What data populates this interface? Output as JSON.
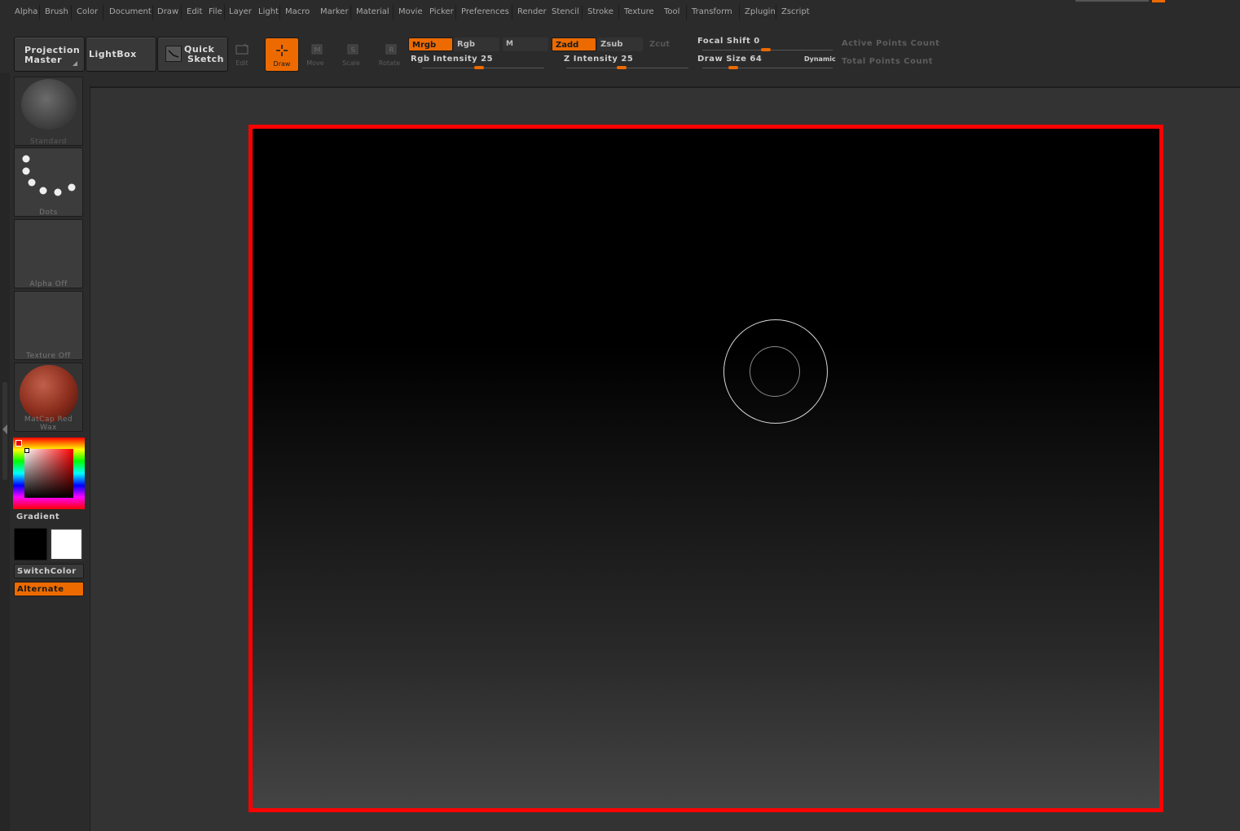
{
  "menu": [
    "Alpha",
    "Brush",
    "Color",
    "Document",
    "Draw",
    "Edit",
    "File",
    "Layer",
    "Light",
    "Macro",
    "Marker",
    "Material",
    "Movie",
    "Picker",
    "Preferences",
    "Render",
    "Stencil",
    "Stroke",
    "Texture",
    "Tool",
    "Transform",
    "Zplugin",
    "Zscript"
  ],
  "toolbar": {
    "projection_master": {
      "line1": "Projection",
      "line2": "Master"
    },
    "lightbox": "LightBox",
    "quick_sketch": {
      "line1": "Quick",
      "line2": "Sketch"
    },
    "edit": "Edit",
    "draw": "Draw",
    "move": "Move",
    "scale": "Scale",
    "rotate": "Rotate",
    "mrgb": "Mrgb",
    "rgb": "Rgb",
    "m": "M",
    "zadd": "Zadd",
    "zsub": "Zsub",
    "zcut": "Zcut",
    "rgb_intensity": "Rgb Intensity 25",
    "z_intensity": "Z Intensity 25",
    "focal_shift": "Focal Shift 0",
    "draw_size": "Draw Size 64",
    "dynamic": "Dynamic",
    "active_points": "Active Points Count",
    "total_points": "Total Points Count"
  },
  "toolbar_values": {
    "rgb_intensity": 25,
    "z_intensity": 25,
    "focal_shift": 0,
    "draw_size": 64
  },
  "sidebar": {
    "brush": "Standard",
    "stroke": "Dots",
    "alpha": "Alpha Off",
    "texture": "Texture Off",
    "material": "MatCap Red Wax",
    "gradient": "Gradient",
    "switch_color": "SwitchColor",
    "alternate": "Alternate"
  },
  "colors": {
    "accent": "#ec6a00",
    "document_border": "#ff0000",
    "primary_color": "#000000",
    "secondary_color": "#ffffff"
  }
}
